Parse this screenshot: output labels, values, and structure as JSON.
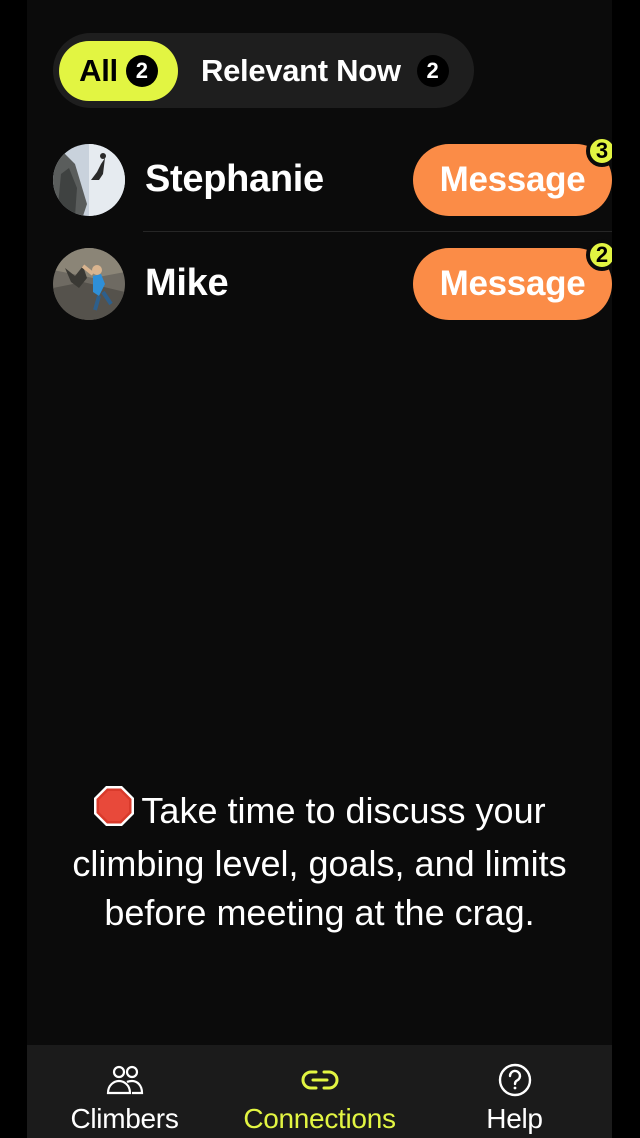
{
  "filters": {
    "all": {
      "label": "All",
      "count": "2"
    },
    "relevant": {
      "label": "Relevant Now",
      "count": "2"
    }
  },
  "connections": [
    {
      "name": "Stephanie",
      "button_label": "Message",
      "unread": "3",
      "avatar_icon": "climber-photo"
    },
    {
      "name": "Mike",
      "button_label": "Message",
      "unread": "2",
      "avatar_icon": "climber-photo"
    }
  ],
  "safety_note": {
    "icon": "stop-sign-icon",
    "text": "Take time to discuss your climbing level, goals, and limits before meeting at the crag."
  },
  "nav": {
    "items": [
      {
        "label": "Climbers",
        "icon": "people-icon"
      },
      {
        "label": "Connections",
        "icon": "link-icon",
        "active": true
      },
      {
        "label": "Help",
        "icon": "help-circle-icon"
      }
    ]
  },
  "colors": {
    "accent": "#e2f542",
    "message_button": "#fb8c47",
    "background": "#0b0b0b"
  }
}
